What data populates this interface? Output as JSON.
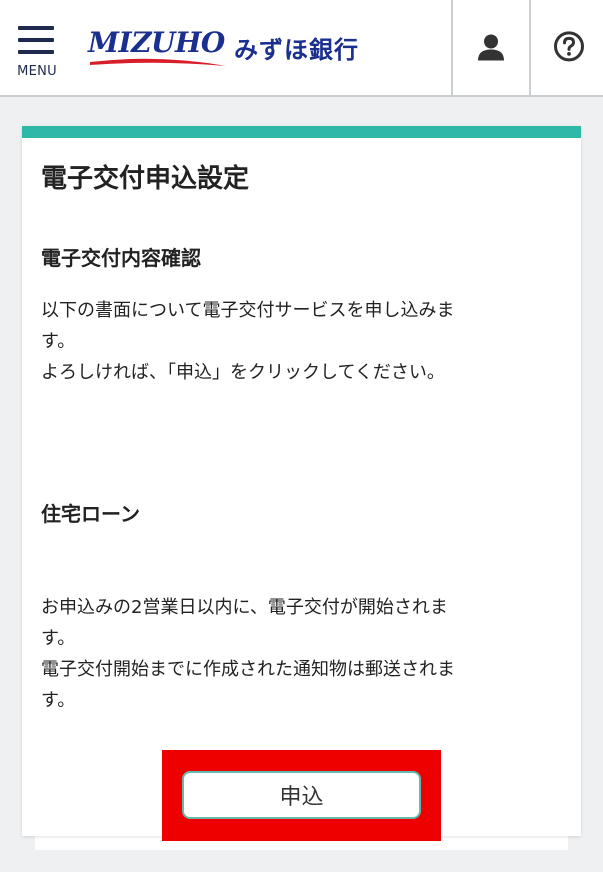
{
  "header": {
    "menu_label": "MENU",
    "logo_en": "MIZUHO",
    "logo_jp": "みずほ銀行"
  },
  "main": {
    "title": "電子交付申込設定",
    "section1": {
      "heading": "電子交付内容確認",
      "lines": [
        "以下の書面について電子交付サービスを申し込みま",
        "す。",
        "よろしければ、「申込」をクリックしてください。"
      ]
    },
    "section2": {
      "heading": "住宅ローン",
      "lines": [
        "お申込みの2営業日以内に、電子交付が開始されま",
        "す。",
        "電子交付開始までに作成された通知物は郵送されま",
        "す。"
      ]
    },
    "apply_label": "申込"
  },
  "colors": {
    "accent_teal": "#2fb7a7",
    "brand_navy": "#1b2f8f",
    "highlight_red": "#ee0000"
  }
}
